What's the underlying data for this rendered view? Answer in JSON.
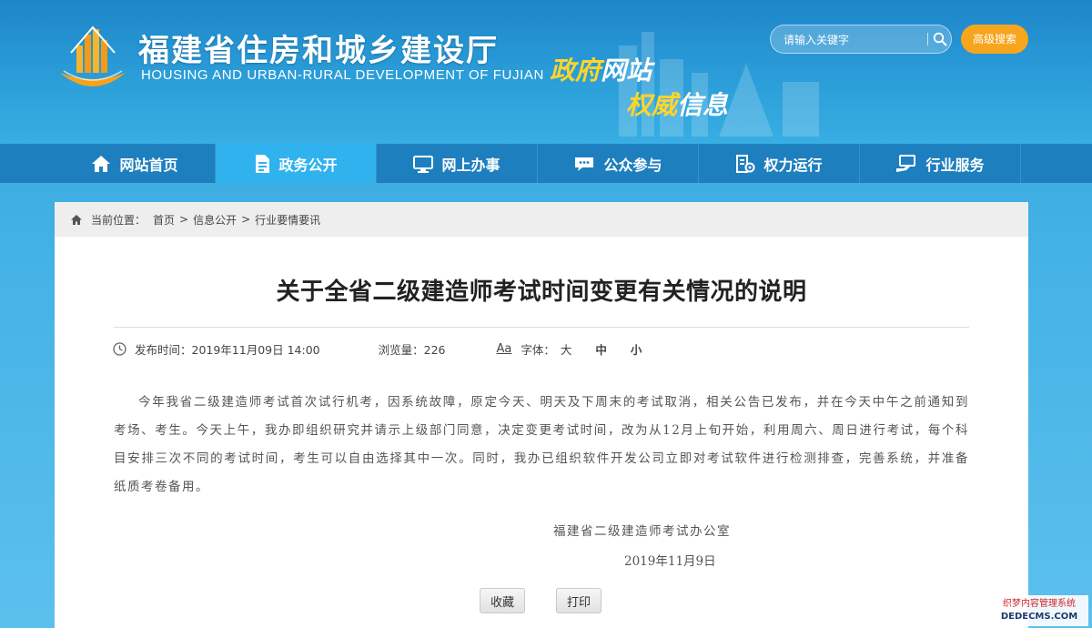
{
  "header": {
    "title": "福建省住房和城乡建设厅",
    "subtitle": "HOUSING AND URBAN-RURAL DEVELOPMENT OF FUJIAN",
    "slogan_line1_highlight": "政府",
    "slogan_line1_rest": "网站",
    "slogan_line2_highlight": "权威",
    "slogan_line2_rest": "信息",
    "search_placeholder": "请输入关键字",
    "advanced_search_label": "高级搜索"
  },
  "nav": {
    "items": [
      {
        "label": "网站首页",
        "icon": "home-icon"
      },
      {
        "label": "政务公开",
        "icon": "document-icon",
        "active": true
      },
      {
        "label": "网上办事",
        "icon": "monitor-icon"
      },
      {
        "label": "公众参与",
        "icon": "chat-icon"
      },
      {
        "label": "权力运行",
        "icon": "power-icon"
      },
      {
        "label": "行业服务",
        "icon": "service-icon"
      }
    ]
  },
  "breadcrumb": {
    "prefix": "当前位置：",
    "items": [
      "首页",
      "信息公开",
      "行业要情要讯"
    ],
    "separator": ">"
  },
  "article": {
    "title": "关于全省二级建造师考试时间变更有关情况的说明",
    "publish_time": "发布时间：2019年11月09日 14:00",
    "views": "浏览量：226",
    "font_aa": "Aa",
    "font_label": "字体：",
    "font_large": "大",
    "font_medium": "中",
    "font_small": "小",
    "body": "今年我省二级建造师考试首次试行机考，因系统故障，原定今天、明天及下周末的考试取消，相关公告已发布，并在今天中午之前通知到考场、考生。今天上午，我办即组织研究并请示上级部门同意，决定变更考试时间，改为从12月上旬开始，利用周六、周日进行考试，每个科目安排三次不同的考试时间，考生可以自由选择其中一次。同时，我办已组织软件开发公司立即对考试软件进行检测排查，完善系统，并准备纸质考卷备用。",
    "signature": "福建省二级建造师考试办公室",
    "sign_date": "2019年11月9日"
  },
  "actions": {
    "favorite": "收藏",
    "print": "打印"
  },
  "watermark": {
    "line1": "织梦内容管理系统",
    "line2": "DEDECMS.COM"
  },
  "colors": {
    "nav_bg": "#1e7fbf",
    "nav_active": "#30b2ef",
    "adv_search": "#f7a51c",
    "slogan_highlight": "#ffd52b"
  }
}
